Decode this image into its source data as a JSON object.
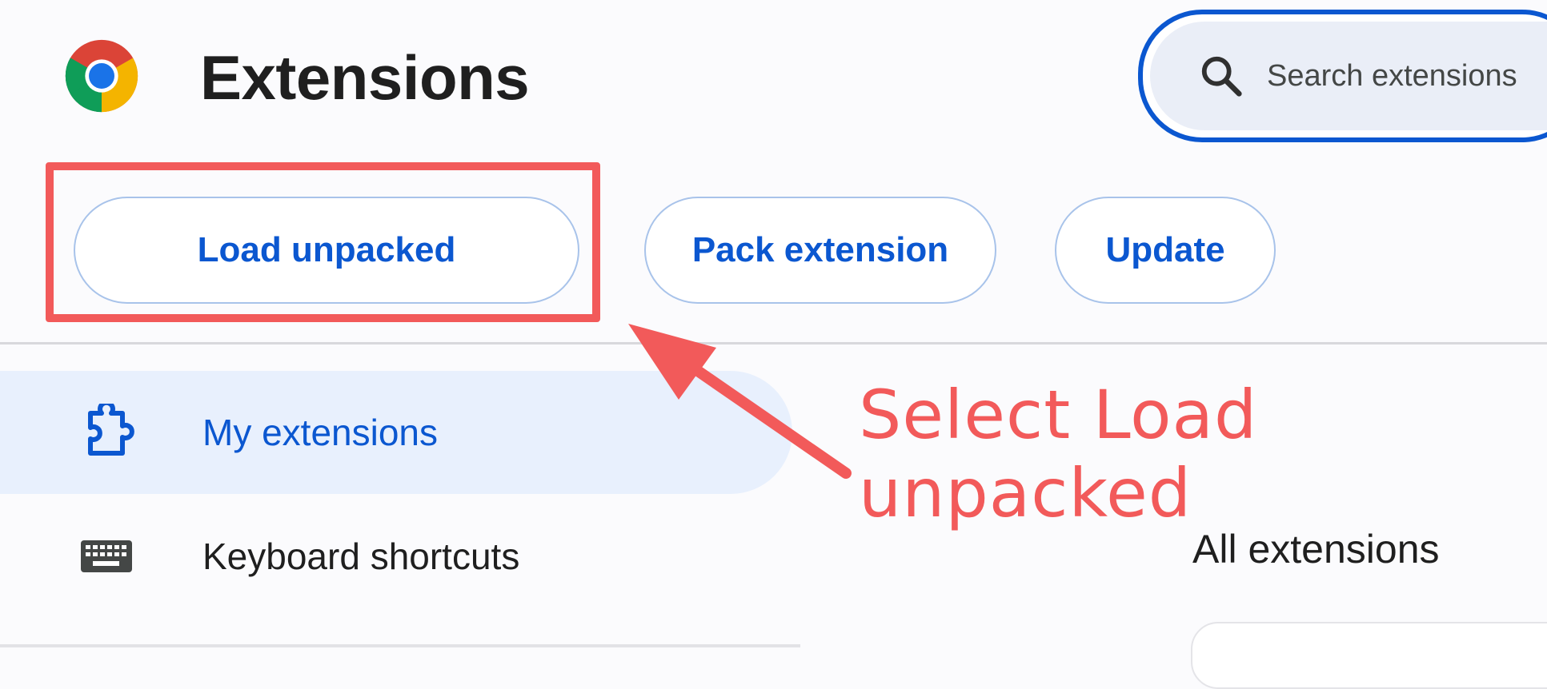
{
  "header": {
    "title": "Extensions",
    "search": {
      "placeholder": "Search extensions"
    }
  },
  "toolbar": {
    "load_unpacked": "Load unpacked",
    "pack_extension": "Pack extension",
    "update": "Update"
  },
  "sidebar": {
    "items": [
      {
        "label": "My extensions",
        "icon": "puzzle-icon",
        "active": true
      },
      {
        "label": "Keyboard shortcuts",
        "icon": "keyboard-icon",
        "active": false
      }
    ]
  },
  "main": {
    "section_title": "All extensions"
  },
  "annotation": {
    "text": "Select Load unpacked",
    "color": "#f25a5a"
  },
  "colors": {
    "accent": "#0b57d0",
    "active_nav_bg": "#e8f0fd",
    "annotation": "#f25a5a"
  }
}
